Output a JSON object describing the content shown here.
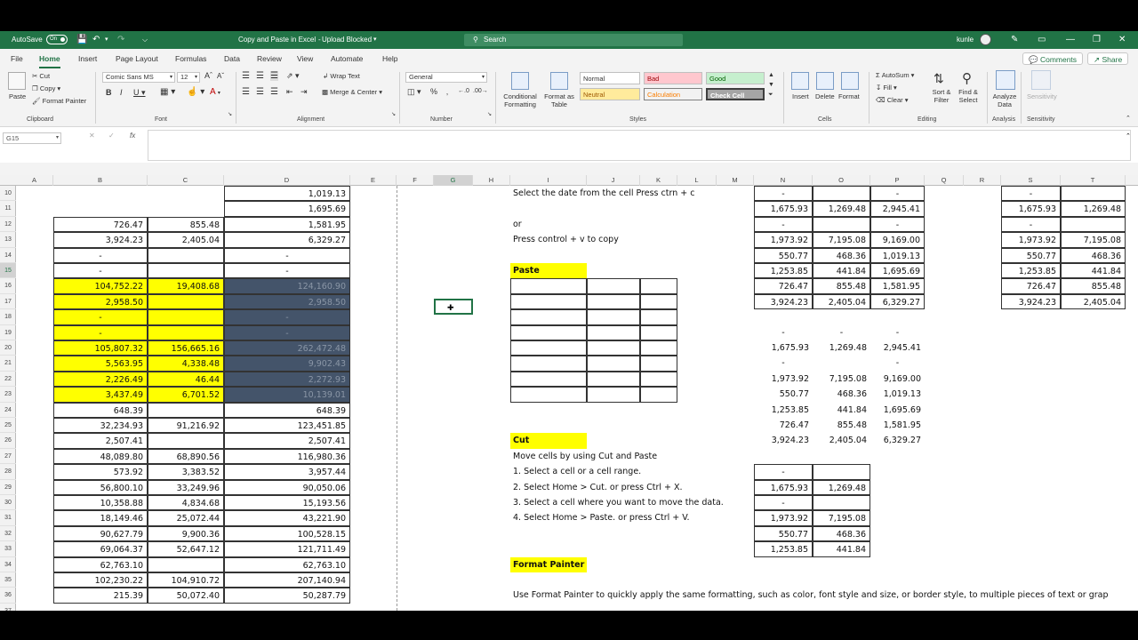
{
  "titlebar": {
    "autosave_label": "AutoSave",
    "autosave_state": "On",
    "doc_title": "Copy and Paste in Excel",
    "upload_status": "Upload Blocked",
    "search_placeholder": "Search",
    "user": "kunle"
  },
  "menu": {
    "tabs": [
      "File",
      "Home",
      "Insert",
      "Page Layout",
      "Formulas",
      "Data",
      "Review",
      "View",
      "Automate",
      "Help"
    ],
    "active": "Home",
    "comments": "Comments",
    "share": "Share"
  },
  "ribbon": {
    "paste": "Paste",
    "cut": "Cut",
    "copy": "Copy",
    "format_painter": "Format Painter",
    "clipboard": "Clipboard",
    "font_name": "Comic Sans MS",
    "font_size": "12",
    "font": "Font",
    "wrap_text": "Wrap Text",
    "merge_center": "Merge & Center",
    "alignment": "Alignment",
    "number_format": "General",
    "number": "Number",
    "conditional_formatting": "Conditional Formatting",
    "format_as_table": "Format as Table",
    "styles": {
      "normal": "Normal",
      "bad": "Bad",
      "good": "Good",
      "neutral": "Neutral",
      "calculation": "Calculation",
      "check_cell": "Check Cell"
    },
    "styles_label": "Styles",
    "insert": "Insert",
    "delete": "Delete",
    "format": "Format",
    "cells": "Cells",
    "autosum": "AutoSum",
    "fill": "Fill",
    "clear": "Clear",
    "sort_filter": "Sort & Filter",
    "find_select": "Find & Select",
    "editing": "Editing",
    "analyze_data": "Analyze Data",
    "analysis": "Analysis",
    "sensitivity": "Sensitivity"
  },
  "formula_bar": {
    "name_box": "G15",
    "fx": "fx"
  },
  "columns": [
    "A",
    "B",
    "C",
    "D",
    "E",
    "F",
    "G",
    "H",
    "I",
    "J",
    "K",
    "L",
    "M",
    "N",
    "O",
    "P",
    "Q",
    "R",
    "S",
    "T"
  ],
  "rows": [
    "10",
    "11",
    "12",
    "13",
    "14",
    "15",
    "16",
    "17",
    "18",
    "19",
    "20",
    "21",
    "22",
    "23",
    "24",
    "25",
    "26",
    "27",
    "28",
    "29",
    "30",
    "31",
    "32",
    "33",
    "34",
    "35",
    "36",
    "37"
  ],
  "sheet": {
    "B": [
      "",
      "",
      "726.47",
      "3,924.23",
      "-",
      "-",
      "104,752.22",
      "2,958.50",
      "-",
      "-",
      "105,807.32",
      "5,563.95",
      "2,226.49",
      "3,437.49",
      "648.39",
      "32,234.93",
      "2,507.41",
      "48,089.80",
      "573.92",
      "56,800.10",
      "10,358.88",
      "18,149.46",
      "90,627.79",
      "69,064.37",
      "62,763.10",
      "102,230.22",
      "215.39",
      ""
    ],
    "C": [
      "",
      "",
      "855.48",
      "2,405.04",
      "",
      "",
      "19,408.68",
      "",
      "",
      "",
      "156,665.16",
      "4,338.48",
      "46.44",
      "6,701.52",
      "",
      "91,216.92",
      "",
      "68,890.56",
      "3,383.52",
      "33,249.96",
      "4,834.68",
      "25,072.44",
      "9,900.36",
      "52,647.12",
      "",
      "104,910.72",
      "50,072.40",
      ""
    ],
    "D": [
      "1,019.13",
      "1,695.69",
      "1,581.95",
      "6,329.27",
      "-",
      "-",
      "124,160.90",
      "2,958.50",
      "-",
      "-",
      "262,472.48",
      "9,902.43",
      "2,272.93",
      "10,139.01",
      "648.39",
      "123,451.85",
      "2,507.41",
      "116,980.36",
      "3,957.44",
      "90,050.06",
      "15,193.56",
      "43,221.90",
      "100,528.15",
      "121,711.49",
      "62,763.10",
      "207,140.94",
      "50,287.79",
      ""
    ],
    "N": [
      "-",
      "1,675.93",
      "-",
      "1,973.92",
      "550.77",
      "1,253.85",
      "726.47",
      "3,924.23",
      "",
      "-",
      "1,675.93",
      "-",
      "1,973.92",
      "550.77",
      "1,253.85",
      "726.47",
      "3,924.23",
      "",
      "-",
      "1,675.93",
      "-",
      "1,973.92",
      "550.77",
      "1,253.85",
      "",
      "",
      "",
      ""
    ],
    "O": [
      "",
      "1,269.48",
      "",
      "7,195.08",
      "468.36",
      "441.84",
      "855.48",
      "2,405.04",
      "",
      "-",
      "1,269.48",
      "",
      "7,195.08",
      "468.36",
      "441.84",
      "855.48",
      "2,405.04",
      "",
      "",
      "1,269.48",
      "",
      "7,195.08",
      "468.36",
      "441.84",
      "",
      "",
      "",
      ""
    ],
    "P": [
      "-",
      "2,945.41",
      "-",
      "9,169.00",
      "1,019.13",
      "1,695.69",
      "1,581.95",
      "6,329.27",
      "",
      "-",
      "2,945.41",
      "-",
      "9,169.00",
      "1,019.13",
      "1,695.69",
      "1,581.95",
      "6,329.27",
      "",
      "",
      "",
      "",
      "",
      "",
      "",
      "",
      "",
      "",
      ""
    ],
    "S": [
      "-",
      "1,675.93",
      "-",
      "1,973.92",
      "550.77",
      "1,253.85",
      "726.47",
      "3,924.23",
      "",
      "",
      "",
      "",
      "",
      "",
      "",
      "",
      "",
      "",
      "",
      "",
      "",
      "",
      "",
      "",
      "",
      "",
      "",
      ""
    ],
    "T": [
      "",
      "1,269.48",
      "",
      "7,195.08",
      "468.36",
      "441.84",
      "855.48",
      "2,405.04",
      "",
      "",
      "",
      "",
      "",
      "",
      "",
      "",
      "",
      "",
      "",
      "",
      "",
      "",
      "",
      "",
      "",
      "",
      "",
      ""
    ],
    "I": [
      "Select the date from the cell  Press ctrn + c",
      "",
      "or",
      "Press control  + v to copy",
      "",
      "Paste",
      "",
      "",
      "",
      "",
      "",
      "",
      "",
      "",
      "",
      "",
      "Cut",
      "Move cells by using Cut and Paste",
      "1. Select a cell or a cell range.",
      "2. Select Home > Cut. or press Ctrl + X.",
      "3. Select a cell where you want to move the data.",
      "4. Select Home > Paste. or press Ctrl + V.",
      "",
      "",
      "Format Painter",
      "",
      "Use Format Painter to quickly apply the same formatting, such as color, font style and size, or border style, to multiple pieces of text or grap",
      ""
    ]
  },
  "colors": {
    "excel_green": "#217346",
    "highlight_yellow": "#ffff00",
    "dark_fill": "#44546a"
  }
}
